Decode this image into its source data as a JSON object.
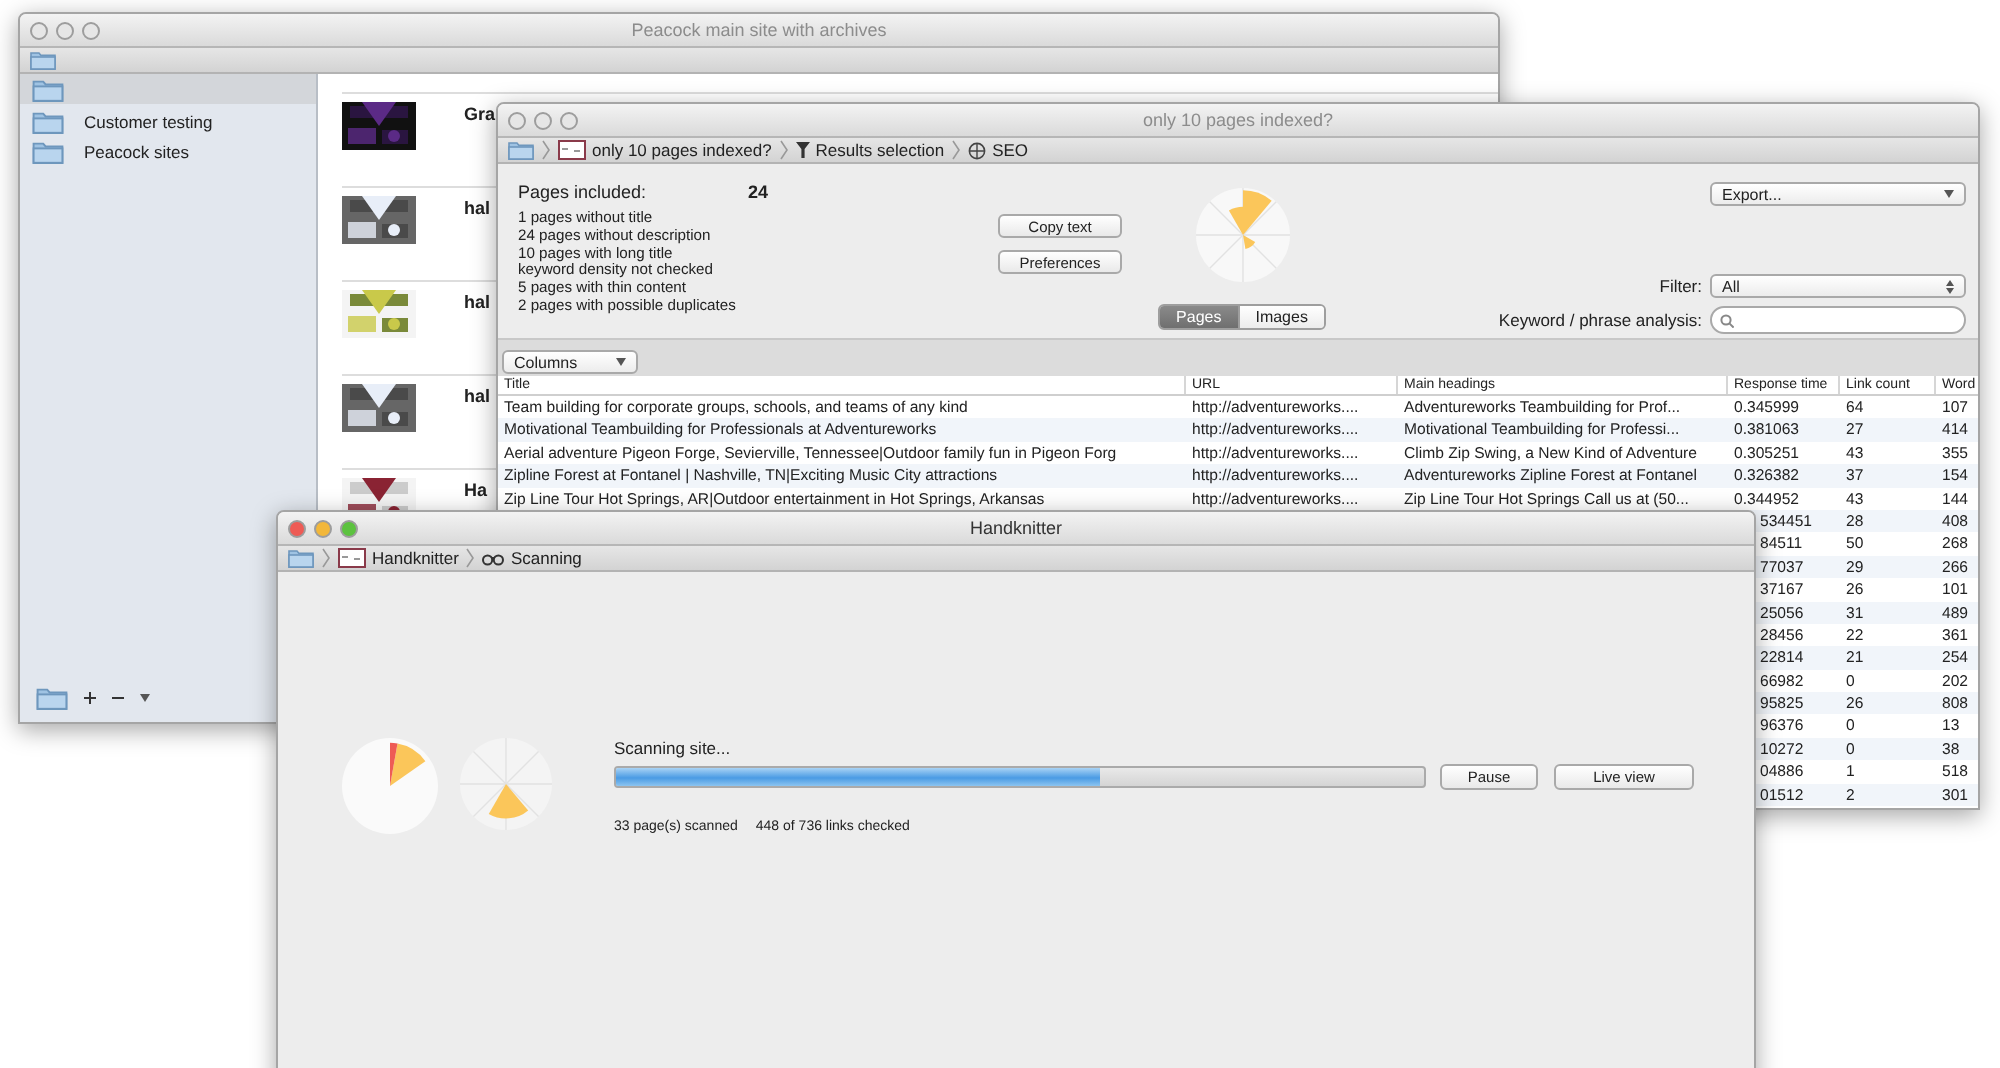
{
  "archive_window": {
    "title": "Peacock main site with archives",
    "active": false,
    "breadcrumb": [
      {
        "kind": "folder"
      }
    ],
    "sidebar": {
      "items": [
        {
          "selected": true
        },
        {
          "label": "Customer testing",
          "selected": false
        },
        {
          "label": "Peacock sites",
          "selected": false
        }
      ]
    },
    "pages": [
      {
        "title": "Gra"
      },
      {
        "title": "hal"
      },
      {
        "title": "hal"
      },
      {
        "title": "hal"
      },
      {
        "title": "Ha"
      }
    ]
  },
  "results_window": {
    "title": "only 10 pages indexed?",
    "active": false,
    "breadcrumb": [
      {
        "kind": "folder"
      },
      {
        "kind": "site",
        "label": "only 10 pages indexed?"
      },
      {
        "kind": "filter",
        "label": "Results selection"
      },
      {
        "kind": "seo",
        "label": "SEO"
      }
    ],
    "pages_included_label": "Pages included:",
    "pages_included_value": "24",
    "issues": [
      "1 pages without title",
      "24 pages without description",
      "10 pages with long title",
      "keyword density not checked",
      "5 pages with thin content",
      "2 pages with possible duplicates"
    ],
    "buttons": [
      "Copy text",
      "Preferences"
    ],
    "view_tabs": [
      {
        "label": "Pages",
        "selected": true
      },
      {
        "label": "Images",
        "selected": false
      }
    ],
    "export": {
      "value": "Export..."
    },
    "filter": {
      "label": "Filter:",
      "value": "All"
    },
    "keyword": {
      "label": "Keyword / phrase analysis:"
    },
    "columns_menu": "Columns",
    "table": {
      "columns": [
        "Title",
        "URL",
        "Main headings",
        "Response time",
        "Link count",
        "Word"
      ],
      "rows": [
        {
          "title": "Team building for corporate groups, schools, and teams of any kind",
          "url": "http://adventureworks....",
          "main_heading": "Adventureworks Teambuilding for Prof...",
          "response_time": "0.345999",
          "link_count": "64",
          "words": "107"
        },
        {
          "title": "Motivational Teambuilding for Professionals at Adventureworks",
          "url": "http://adventureworks....",
          "main_heading": "Motivational Teambuilding for Professi...",
          "response_time": "0.381063",
          "link_count": "27",
          "words": "414"
        },
        {
          "title": "Aerial adventure Pigeon Forge, Sevierville, Tennessee|Outdoor family fun in Pigeon Forg",
          "url": "http://adventureworks....",
          "main_heading": "Climb Zip Swing, a New Kind of Adventure",
          "response_time": "0.305251",
          "link_count": "43",
          "words": "355"
        },
        {
          "title": "Zipline Forest at Fontanel | Nashville, TN|Exciting Music City attractions",
          "url": "http://adventureworks....",
          "main_heading": "Adventureworks Zipline Forest at Fontanel",
          "response_time": "0.326382",
          "link_count": "37",
          "words": "154"
        },
        {
          "title": "Zip Line Tour Hot Springs, AR|Outdoor entertainment in Hot Springs, Arkansas",
          "url": "http://adventureworks....",
          "main_heading": "Zip Line Tour Hot Springs Call us at (50...",
          "response_time": "0.344952",
          "link_count": "43",
          "words": "144"
        },
        {
          "response_time": "534451",
          "link_count": "28",
          "words": "408"
        },
        {
          "response_time": "84511",
          "link_count": "50",
          "words": "268"
        },
        {
          "response_time": "77037",
          "link_count": "29",
          "words": "266"
        },
        {
          "response_time": "37167",
          "link_count": "26",
          "words": "101"
        },
        {
          "response_time": "25056",
          "link_count": "31",
          "words": "489"
        },
        {
          "response_time": "28456",
          "link_count": "22",
          "words": "361"
        },
        {
          "response_time": "22814",
          "link_count": "21",
          "words": "254"
        },
        {
          "response_time": "66982",
          "link_count": "0",
          "words": "202"
        },
        {
          "response_time": "95825",
          "link_count": "26",
          "words": "808"
        },
        {
          "response_time": "96376",
          "link_count": "0",
          "words": "13"
        },
        {
          "response_time": "10272",
          "link_count": "0",
          "words": "38"
        },
        {
          "response_time": "04886",
          "link_count": "1",
          "words": "518"
        },
        {
          "response_time": "01512",
          "link_count": "2",
          "words": "301"
        }
      ]
    }
  },
  "scan_window": {
    "title": "Handknitter",
    "active": true,
    "breadcrumb": [
      {
        "kind": "folder"
      },
      {
        "kind": "site",
        "label": "Handknitter"
      },
      {
        "kind": "scan",
        "label": "Scanning"
      }
    ],
    "status": "Scanning site...",
    "progress": {
      "level": 0.6
    },
    "buttons": [
      "Pause",
      "Live view"
    ],
    "pages_scanned": "33 page(s) scanned",
    "links_checked": "448 of 736 links checked"
  }
}
